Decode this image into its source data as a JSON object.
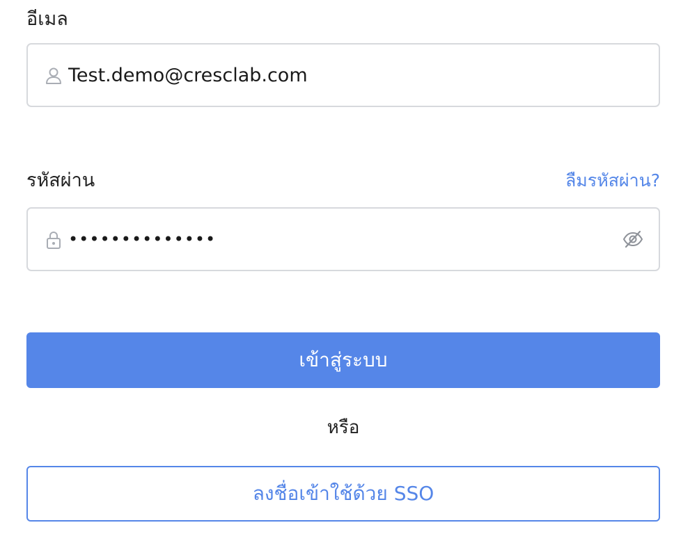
{
  "email": {
    "label": "อีเมล",
    "value": "Test.demo@cresclab.com",
    "icon": "user-icon"
  },
  "password": {
    "label": "รหัสผ่าน",
    "forgot_link": "ลืมรหัสผ่าน?",
    "value": "••••••••••••••",
    "icon": "lock-icon",
    "toggle_icon": "eye-slash-icon"
  },
  "login_button": "เข้าสู่ระบบ",
  "or_text": "หรือ",
  "sso_button": "ลงชื่อเข้าใช้ด้วย SSO",
  "colors": {
    "accent": "#5586e8",
    "border": "#d7d9dd",
    "icon": "#a9adb4"
  }
}
